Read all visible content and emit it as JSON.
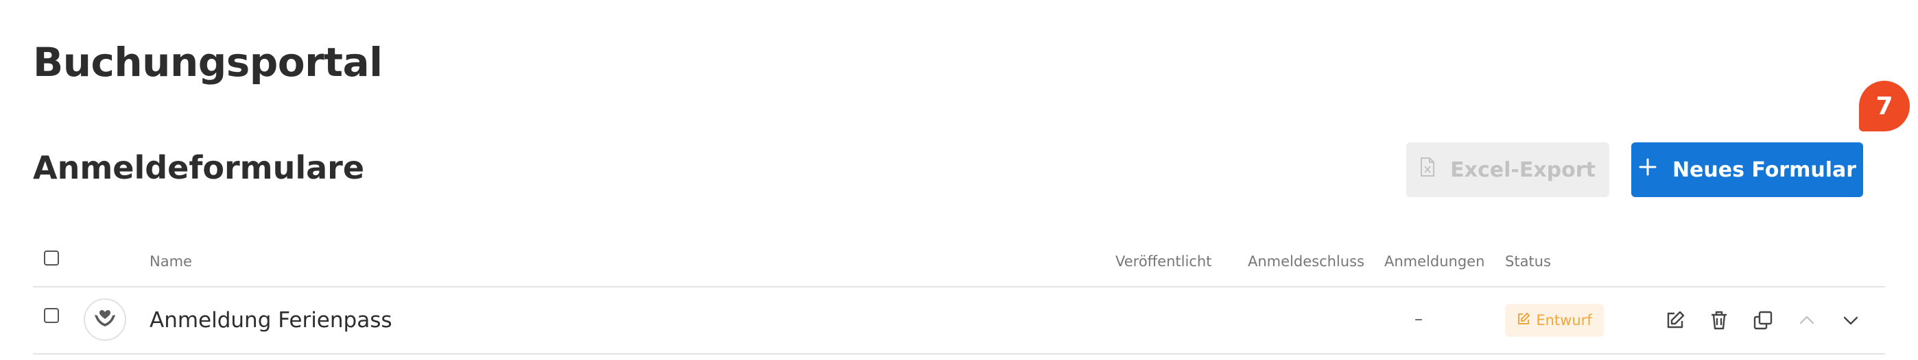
{
  "page": {
    "title": "Buchungsportal"
  },
  "section": {
    "title": "Anmeldeformulare"
  },
  "toolbar": {
    "export_label": "Excel-Export",
    "new_label": "Neues Formular",
    "badge_count": "7"
  },
  "table": {
    "columns": [
      "Name",
      "Veröffentlicht",
      "Anmeldeschluss",
      "Anmeldungen",
      "Status"
    ],
    "rows": [
      {
        "name": "Anmeldung Ferienpass",
        "published": "",
        "deadline": "",
        "registrations": "–",
        "status": "Entwurf"
      }
    ]
  },
  "colors": {
    "primary": "#1476d6",
    "badge": "#ee4a24",
    "status_draft_bg": "#fdf2e3",
    "status_draft_text": "#f0a73c",
    "disabled_bg": "#eeeeee",
    "disabled_text": "#c2c2c2"
  },
  "icons": {
    "export": "excel-file-icon",
    "new": "plus-icon",
    "logo": "hands-heart-icon",
    "status": "edit-icon",
    "actions": [
      "edit-icon",
      "trash-icon",
      "duplicate-icon",
      "chevron-up-icon",
      "chevron-down-icon"
    ]
  }
}
